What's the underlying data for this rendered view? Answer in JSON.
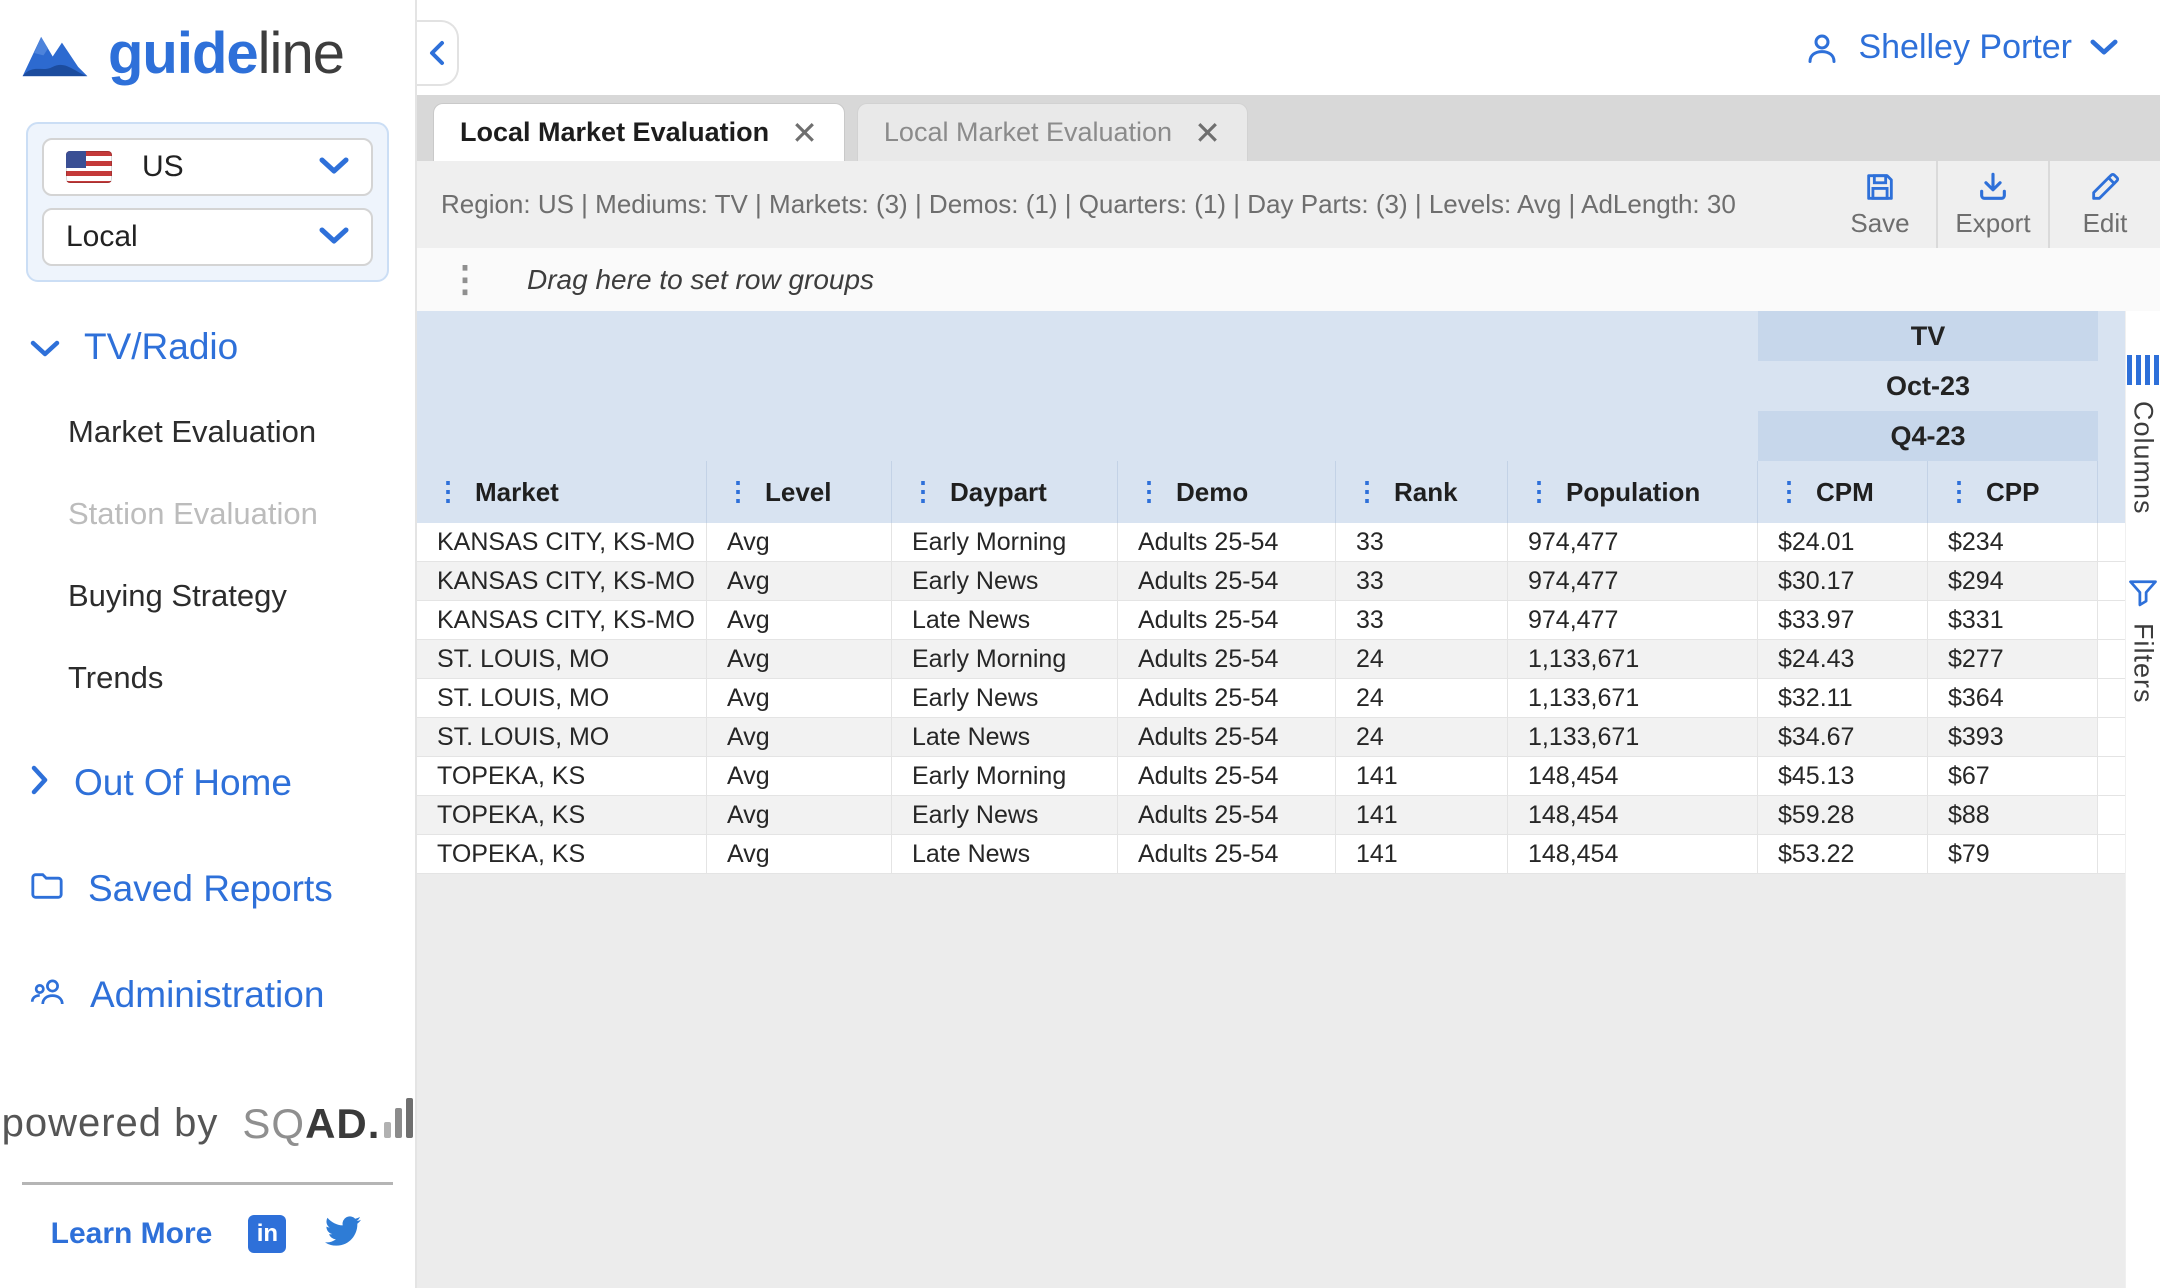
{
  "colors": {
    "accent": "#2e70d9",
    "header_blue": "#d8e3f1",
    "header_blue_dark": "#c7d7eb",
    "tabbar_gray": "#d8d8d8"
  },
  "sidebar": {
    "logo_bold": "guide",
    "logo_light": "line",
    "country_select": {
      "value": "US",
      "icon": "us-flag-icon"
    },
    "market_type_select": {
      "value": "Local"
    },
    "nav": {
      "tv_radio": "TV/Radio",
      "market_evaluation": "Market Evaluation",
      "station_evaluation": "Station Evaluation",
      "buying_strategy": "Buying Strategy",
      "trends": "Trends",
      "out_of_home": "Out Of Home",
      "saved_reports": "Saved Reports",
      "administration": "Administration"
    },
    "powered_by": "powered by",
    "sqad_sq": "SQ",
    "sqad_ad": "AD",
    "sqad_dot": ".",
    "learn_more": "Learn More",
    "linkedin_glyph": "in"
  },
  "header": {
    "user_name": "Shelley Porter"
  },
  "tabs": [
    {
      "label": "Local Market Evaluation",
      "active": true
    },
    {
      "label": "Local Market Evaluation",
      "active": false
    }
  ],
  "toolbar": {
    "summary": "Region: US | Mediums: TV | Markets: (3) | Demos: (1) | Quarters: (1) | Day Parts: (3) | Levels: Avg | AdLength: 30",
    "save_label": "Save",
    "export_label": "Export",
    "edit_label": "Edit"
  },
  "grid": {
    "drag_hint": "Drag here to set row groups",
    "group_headers": {
      "medium": "TV",
      "month": "Oct-23",
      "quarter": "Q4-23"
    },
    "columns": [
      "Market",
      "Level",
      "Daypart",
      "Demo",
      "Rank",
      "Population",
      "CPM",
      "CPP"
    ],
    "rows": [
      [
        "KANSAS CITY, KS-MO",
        "Avg",
        "Early Morning",
        "Adults 25-54",
        "33",
        "974,477",
        "$24.01",
        "$234"
      ],
      [
        "KANSAS CITY, KS-MO",
        "Avg",
        "Early News",
        "Adults 25-54",
        "33",
        "974,477",
        "$30.17",
        "$294"
      ],
      [
        "KANSAS CITY, KS-MO",
        "Avg",
        "Late News",
        "Adults 25-54",
        "33",
        "974,477",
        "$33.97",
        "$331"
      ],
      [
        "ST. LOUIS, MO",
        "Avg",
        "Early Morning",
        "Adults 25-54",
        "24",
        "1,133,671",
        "$24.43",
        "$277"
      ],
      [
        "ST. LOUIS, MO",
        "Avg",
        "Early News",
        "Adults 25-54",
        "24",
        "1,133,671",
        "$32.11",
        "$364"
      ],
      [
        "ST. LOUIS, MO",
        "Avg",
        "Late News",
        "Adults 25-54",
        "24",
        "1,133,671",
        "$34.67",
        "$393"
      ],
      [
        "TOPEKA, KS",
        "Avg",
        "Early Morning",
        "Adults 25-54",
        "141",
        "148,454",
        "$45.13",
        "$67"
      ],
      [
        "TOPEKA, KS",
        "Avg",
        "Early News",
        "Adults 25-54",
        "141",
        "148,454",
        "$59.28",
        "$88"
      ],
      [
        "TOPEKA, KS",
        "Avg",
        "Late News",
        "Adults 25-54",
        "141",
        "148,454",
        "$53.22",
        "$79"
      ]
    ]
  },
  "side_rail": {
    "columns_label": "Columns",
    "filters_label": "Filters"
  }
}
